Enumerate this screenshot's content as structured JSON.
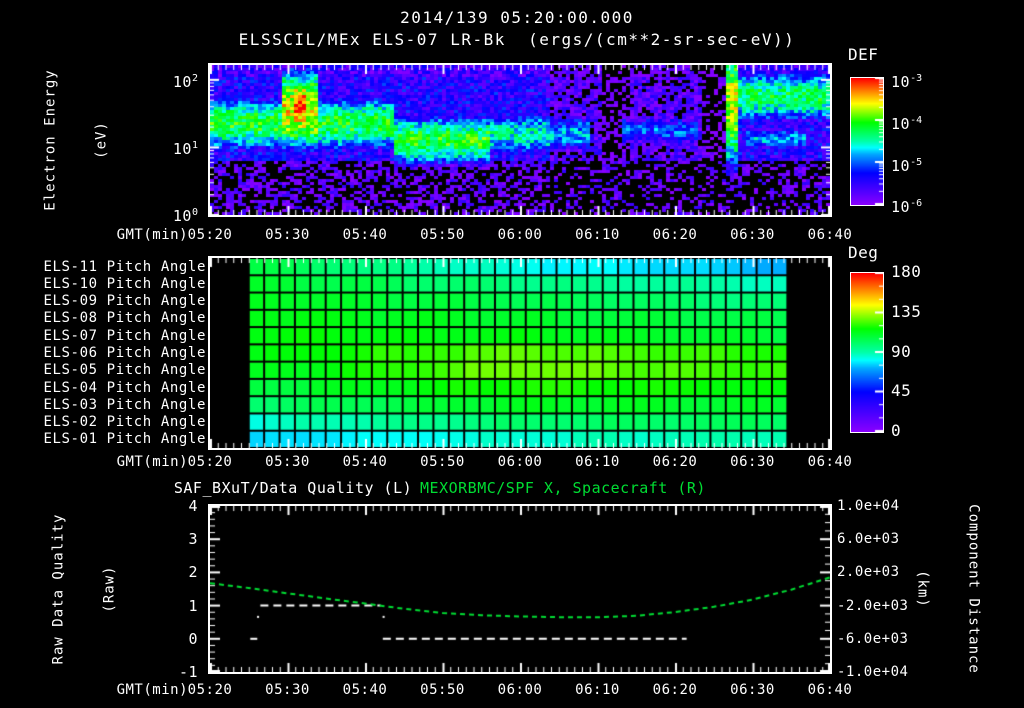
{
  "header": {
    "datetime": "2014/139 05:20:00.000",
    "instrument_title": "ELSSCIL/MEx ELS-07 LR-Bk  (ergs/(cm**2-sr-sec-eV))"
  },
  "time_axis": {
    "label": "GMT(min)",
    "tick_labels": [
      "05:20",
      "05:30",
      "05:40",
      "05:50",
      "06:00",
      "06:10",
      "06:20",
      "06:30",
      "06:40"
    ],
    "minutes_span": 80,
    "minor_tick_min": 1,
    "major_tick_min": 10
  },
  "colors": {
    "accent_green": "#00dd33",
    "frame": "#ffffff",
    "background": "#000000"
  },
  "chart_data": [
    {
      "type": "heatmap",
      "id": "energy_spectrogram",
      "ylabel_line1": "Electron Energy",
      "ylabel_line2": "(eV)",
      "y_log_range": [
        0,
        2.22
      ],
      "ytick_base": "10",
      "ytick_exponents": [
        2,
        1,
        0
      ],
      "colorbar": {
        "title": "DEF",
        "tick_base": "10",
        "tick_exponents": [
          -3,
          -4,
          -5,
          -6
        ],
        "log_range": [
          -6,
          -3
        ]
      },
      "noise_amp": 0.8,
      "background": {
        "low_logE": 0.8,
        "low_base": -5.9,
        "high_base": -5.45,
        "dark_t": [
          44,
          66.5
        ],
        "dark_base": -5.8,
        "dark2_t": [
          [
            50.5,
            54
          ],
          [
            63.5,
            66.4
          ]
        ],
        "dark2_base": -6.15,
        "black_cut": -6.05
      },
      "features": [
        {
          "t": [
            0,
            24
          ],
          "c": 1.35,
          "w": 0.33,
          "p": -4.15
        },
        {
          "t": [
            9.5,
            14
          ],
          "c": 1.55,
          "w": 0.45,
          "p": -3.55
        },
        {
          "t": [
            11,
            12.3
          ],
          "c": 1.62,
          "w": 0.28,
          "p": -3.1
        },
        {
          "t": [
            24,
            36
          ],
          "c": 1.1,
          "w": 0.3,
          "p": -4.1
        },
        {
          "t": [
            36,
            44
          ],
          "c": 1.2,
          "w": 0.28,
          "p": -4.55
        },
        {
          "t": [
            44,
            49
          ],
          "c": 1.2,
          "w": 0.25,
          "p": -4.8
        },
        {
          "t": [
            53,
            63
          ],
          "c": 1.25,
          "w": 0.22,
          "p": -5.05
        },
        {
          "t": [
            66.5,
            68.3
          ],
          "c": 1.55,
          "w": 0.75,
          "p": -4.0,
          "tilt": 0.4
        },
        {
          "t": [
            68.3,
            80
          ],
          "c": 1.75,
          "w": 0.32,
          "p": -4.3
        },
        {
          "t": [
            69,
            77
          ],
          "c": 1.12,
          "w": 0.16,
          "p": -4.85
        }
      ]
    },
    {
      "type": "heatmap",
      "id": "pitch_angles",
      "rows": [
        {
          "label": "ELS-11 Pitch Angle",
          "angles": [
            107,
            83,
            73
          ]
        },
        {
          "label": "ELS-10 Pitch Angle",
          "angles": [
            110,
            97,
            88
          ]
        },
        {
          "label": "ELS-09 Pitch Angle",
          "angles": [
            113,
            105,
            97
          ]
        },
        {
          "label": "ELS-08 Pitch Angle",
          "angles": [
            115,
            110,
            105
          ]
        },
        {
          "label": "ELS-07 Pitch Angle",
          "angles": [
            116,
            114,
            108
          ]
        },
        {
          "label": "ELS-06 Pitch Angle",
          "angles": [
            113,
            127,
            120
          ]
        },
        {
          "label": "ELS-05 Pitch Angle",
          "angles": [
            110,
            130,
            122
          ]
        },
        {
          "label": "ELS-04 Pitch Angle",
          "angles": [
            107,
            120,
            115
          ]
        },
        {
          "label": "ELS-03 Pitch Angle",
          "angles": [
            100,
            112,
            110
          ]
        },
        {
          "label": "ELS-02 Pitch Angle",
          "angles": [
            85,
            100,
            103
          ]
        },
        {
          "label": "ELS-01 Pitch Angle",
          "angles": [
            76,
            86,
            90
          ]
        }
      ],
      "data_window_min": [
        5,
        74.5
      ],
      "cell_minutes": 2,
      "colorbar": {
        "title": "Deg",
        "ticks": [
          180,
          135,
          90,
          45,
          0
        ],
        "range": [
          0,
          180
        ]
      }
    },
    {
      "type": "line",
      "id": "quality_and_distance",
      "title_left": "SAF_BXuT/Data Quality (L)",
      "title_right": "MEXORBMC/SPF X, Spacecraft (R)",
      "left_axis": {
        "label_line1": "Raw Data Quality",
        "label_line2": "(Raw)",
        "range": [
          -1,
          4
        ],
        "ticks": [
          4,
          3,
          2,
          1,
          0,
          -1
        ]
      },
      "right_axis": {
        "label_line1": "Component Distance",
        "label_line2": "(km)",
        "range": [
          -10000,
          10000
        ],
        "tick_labels": [
          "1.0e+04",
          "6.0e+03",
          "2.0e+03",
          "-2.0e+03",
          "-6.0e+03",
          "-1.0e+04"
        ]
      },
      "series": [
        {
          "name": "data_quality",
          "axis": "left",
          "color": "#ffffff",
          "style": "dashed",
          "segments": [
            {
              "t": [
                5.2,
                6.1
              ],
              "v": 0
            },
            {
              "t": [
                6.5,
                22
              ],
              "v": 1
            },
            {
              "t": [
                22.3,
                61.5
              ],
              "v": 0
            }
          ],
          "dots": [
            {
              "t": 6.2,
              "v": 0.66
            },
            {
              "t": 22.4,
              "v": 0.66
            }
          ]
        },
        {
          "name": "spacecraft_x_distance",
          "axis": "right",
          "color": "#00dd33",
          "style": "dashed",
          "points": [
            [
              0,
              700
            ],
            [
              5,
              120
            ],
            [
              10,
              -520
            ],
            [
              15,
              -1150
            ],
            [
              20,
              -1750
            ],
            [
              25,
              -2380
            ],
            [
              30,
              -2900
            ],
            [
              35,
              -3160
            ],
            [
              40,
              -3310
            ],
            [
              45,
              -3390
            ],
            [
              50,
              -3400
            ],
            [
              55,
              -3230
            ],
            [
              60,
              -2780
            ],
            [
              65,
              -2150
            ],
            [
              70,
              -1280
            ],
            [
              75,
              -80
            ],
            [
              80,
              1400
            ]
          ]
        }
      ]
    }
  ]
}
